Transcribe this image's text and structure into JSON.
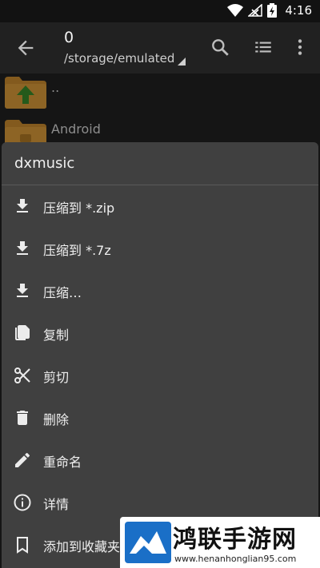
{
  "status_bar": {
    "time": "4:16"
  },
  "toolbar": {
    "title": "0",
    "path": "/storage/emulated"
  },
  "files": [
    {
      "name": ".."
    },
    {
      "name": "Android"
    }
  ],
  "context_menu": {
    "title": "dxmusic",
    "items": [
      {
        "label": "压缩到 *.zip",
        "icon": "download-icon"
      },
      {
        "label": "压缩到 *.7z",
        "icon": "download-icon"
      },
      {
        "label": "压缩…",
        "icon": "download-icon"
      },
      {
        "label": "复制",
        "icon": "copy-icon"
      },
      {
        "label": "剪切",
        "icon": "scissors-icon"
      },
      {
        "label": "删除",
        "icon": "trash-icon"
      },
      {
        "label": "重命名",
        "icon": "pencil-icon"
      },
      {
        "label": "详情",
        "icon": "info-icon"
      },
      {
        "label": "添加到收藏夹",
        "icon": "bookmark-icon"
      }
    ]
  },
  "watermark": {
    "title": "鸿联手游网",
    "url": "www.henanhonglian95.com"
  },
  "colors": {
    "background": "#212121",
    "sheet": "#404040",
    "folder": "#c98a2e",
    "up_arrow": "#3a8a2a"
  }
}
